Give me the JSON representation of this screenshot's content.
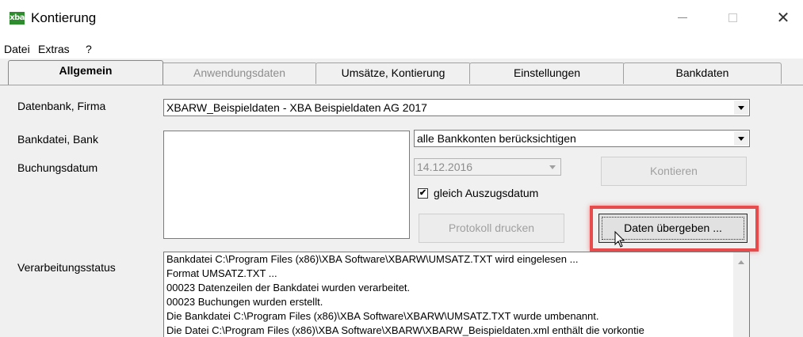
{
  "window": {
    "title": "Kontierung",
    "app_icon_text": "xba",
    "minimize_icon": "minimize-icon",
    "maximize_icon": "maximize-icon",
    "close_icon": "close-icon",
    "close_glyph": "✕"
  },
  "menu": {
    "items": [
      "Datei",
      "Extras",
      "?"
    ]
  },
  "tabs": [
    {
      "label": "Allgemein",
      "state": "active"
    },
    {
      "label": "Anwendungsdaten",
      "state": "disabled"
    },
    {
      "label": "Umsätze, Kontierung",
      "state": "normal"
    },
    {
      "label": "Einstellungen",
      "state": "normal"
    },
    {
      "label": "Bankdaten",
      "state": "normal"
    }
  ],
  "form": {
    "datenbank_label": "Datenbank, Firma",
    "datenbank_value": "XBARW_Beispieldaten - XBA Beispieldaten AG 2017",
    "bankdatei_label": "Bankdatei, Bank",
    "bank_accounts_value": "alle Bankkonten berücksichtigen",
    "buchungsdatum_label": "Buchungsdatum",
    "buchungsdatum_value": "14.12.2016",
    "kontieren_button": "Kontieren",
    "gleich_auszugsdatum_label": "gleich Auszugsdatum",
    "gleich_auszugsdatum_checked": true,
    "check_glyph": "✔",
    "protokoll_button": "Protokoll drucken",
    "daten_uebergeben_button": "Daten übergeben ...",
    "verarbeitungsstatus_label": "Verarbeitungsstatus"
  },
  "status_lines": [
    "Bankdatei C:\\Program Files (x86)\\XBA Software\\XBARW\\UMSATZ.TXT wird eingelesen ...",
    "Format UMSATZ.TXT ...",
    "00023 Datenzeilen der Bankdatei wurden verarbeitet.",
    "00023 Buchungen wurden erstellt.",
    "Die Bankdatei C:\\Program Files (x86)\\XBA Software\\XBARW\\UMSATZ.TXT wurde umbenannt.",
    "Die Datei C:\\Program Files (x86)\\XBA Software\\XBARW\\XBARW_Beispieldaten.xml enthält die vorkontie"
  ],
  "colors": {
    "highlight": "#e84b4b",
    "app_icon_bg": "#2e8b2e"
  }
}
